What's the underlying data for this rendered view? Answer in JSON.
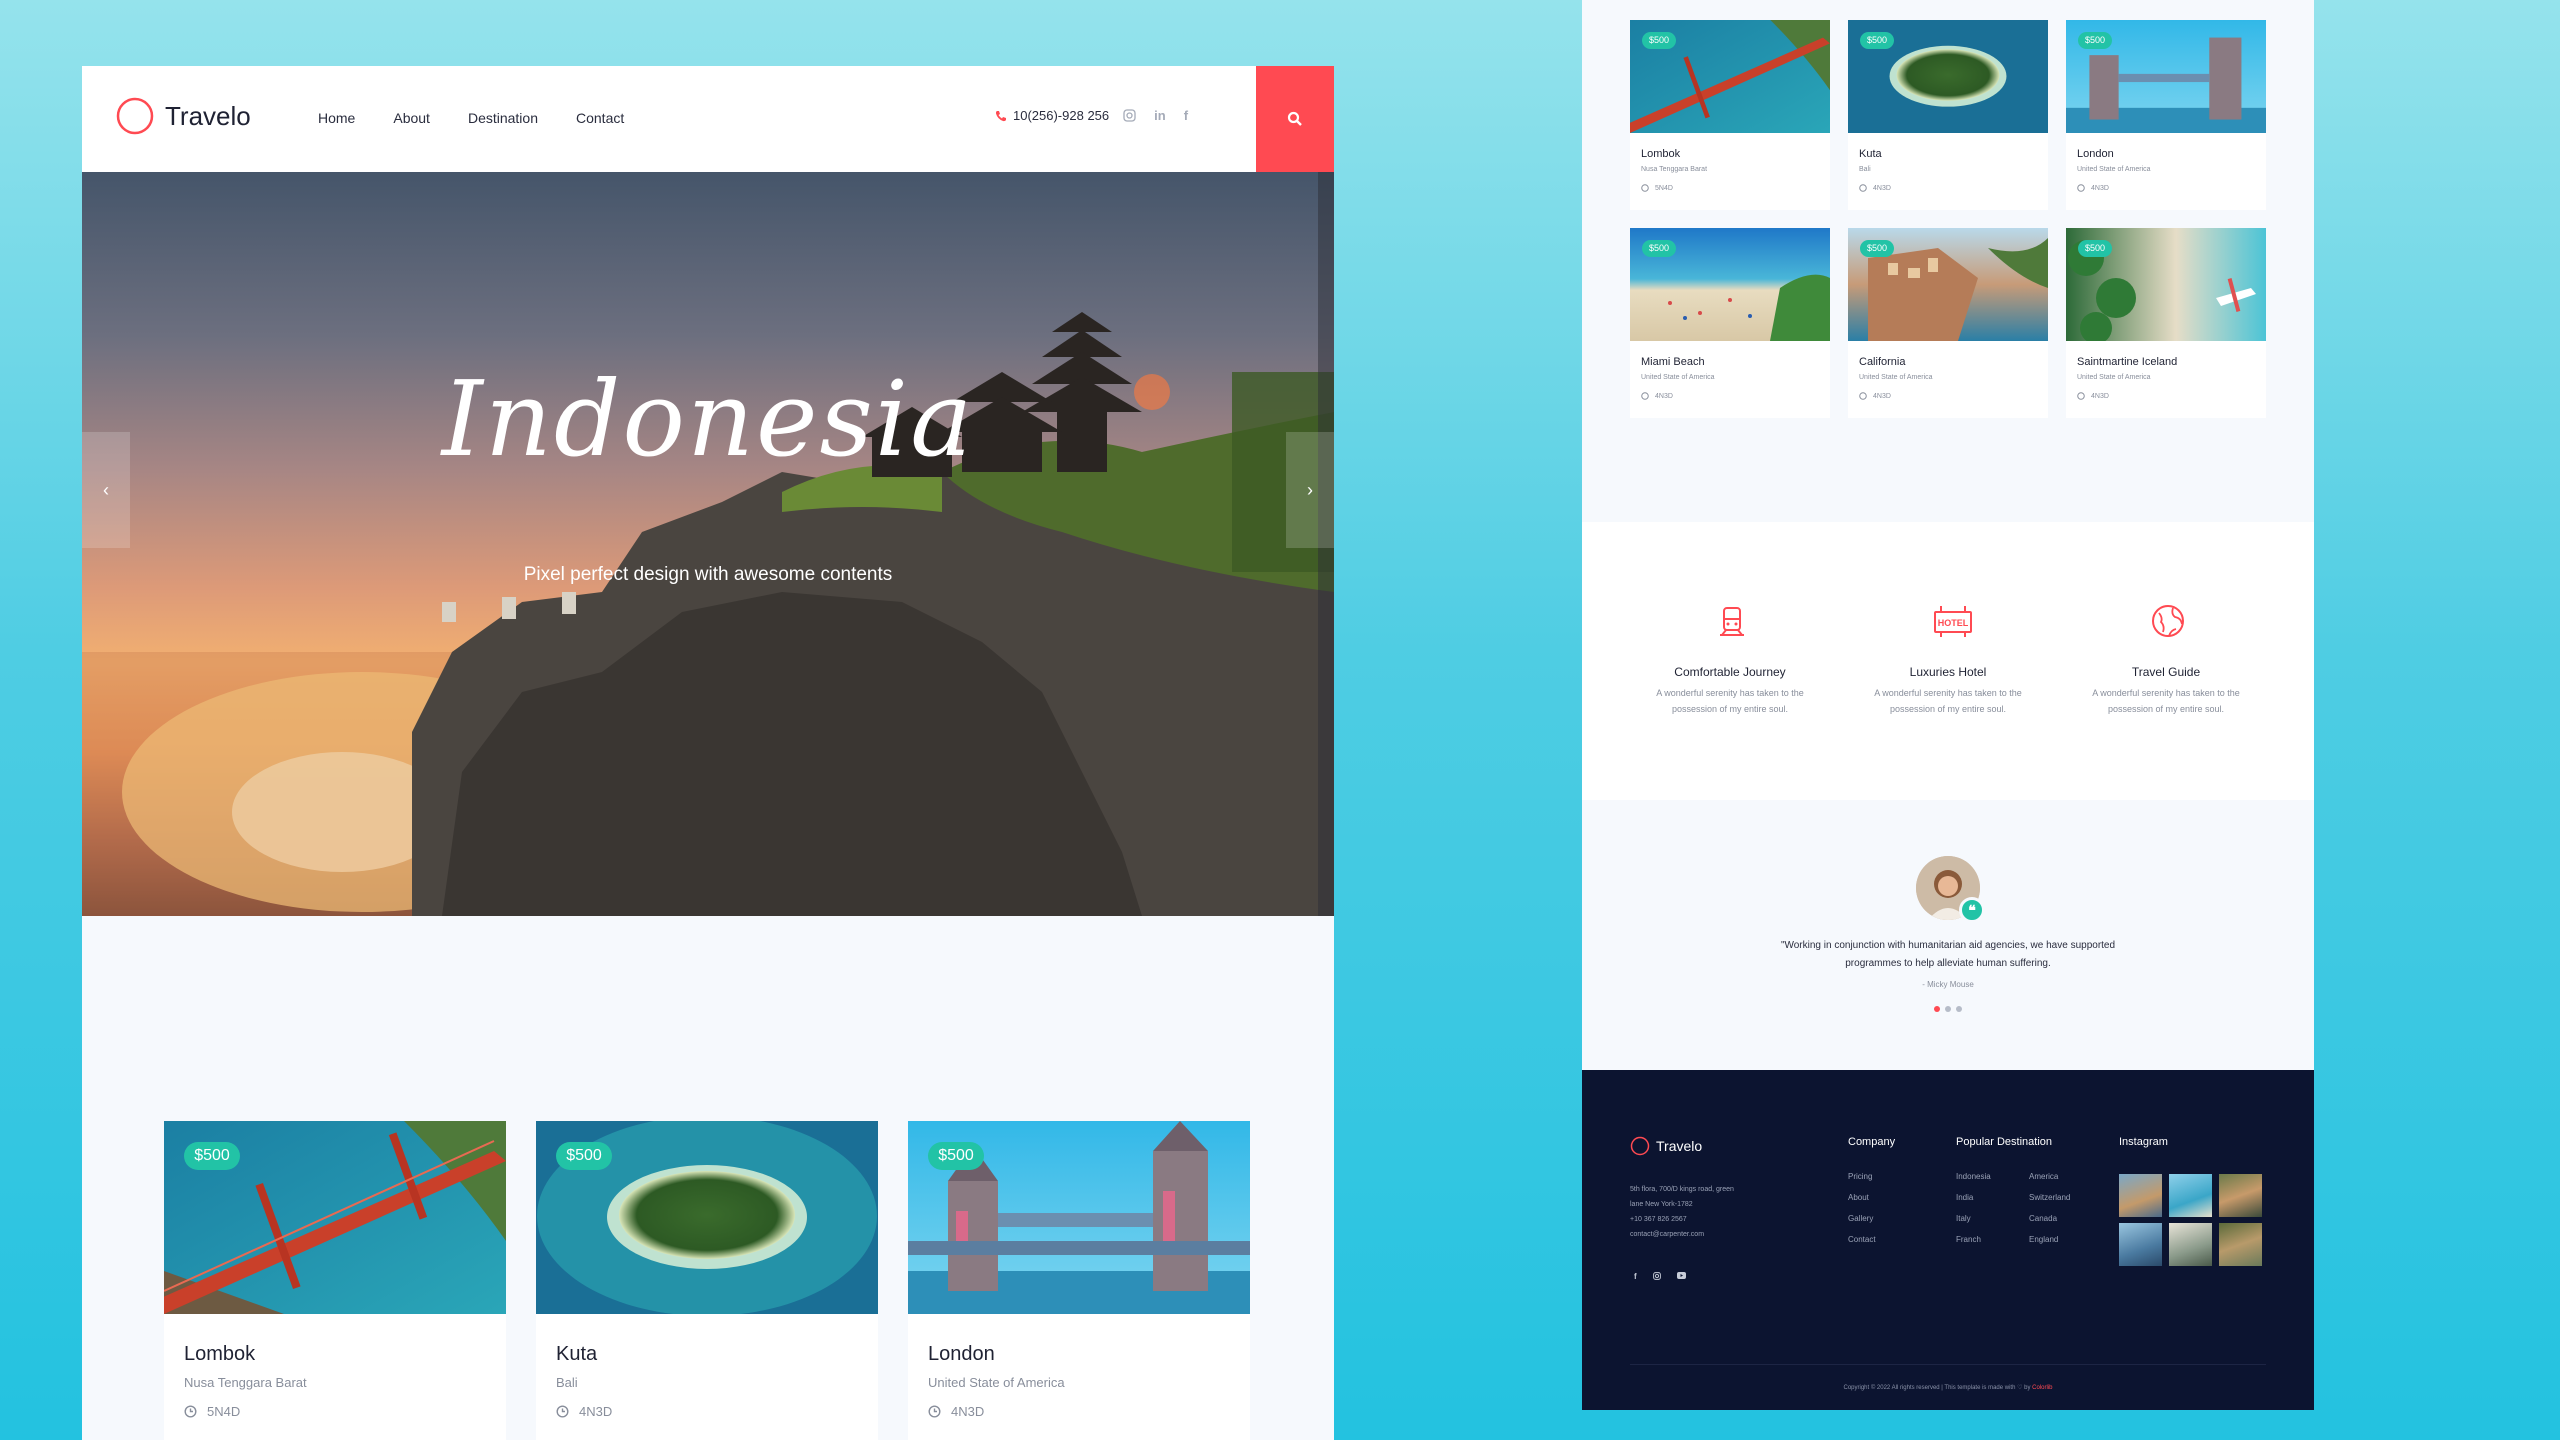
{
  "brand": {
    "name": "Travelo",
    "accent": "#ff4a52",
    "teal": "#22c3a6",
    "footer_bg": "#0c1430"
  },
  "nav": {
    "items": [
      "Home",
      "About",
      "Destination",
      "Contact"
    ],
    "phone": "10(256)-928 256",
    "social_icons": [
      "instagram-icon",
      "linkedin-icon",
      "facebook-icon"
    ],
    "search_icon": "search-icon"
  },
  "hero": {
    "title": "Indonesia",
    "subtitle": "Pixel perfect design with awesome contents",
    "prev": "‹",
    "next": "›"
  },
  "destinations": [
    {
      "price": "$500",
      "name": "Lombok",
      "location": "Nusa Tenggara Barat",
      "duration": "5N4D"
    },
    {
      "price": "$500",
      "name": "Kuta",
      "location": "Bali",
      "duration": "4N3D"
    },
    {
      "price": "$500",
      "name": "London",
      "location": "United State of America",
      "duration": "4N3D"
    },
    {
      "price": "$500",
      "name": "Miami Beach",
      "location": "United State of America",
      "duration": "4N3D"
    },
    {
      "price": "$500",
      "name": "California",
      "location": "United State of America",
      "duration": "4N3D"
    },
    {
      "price": "$500",
      "name": "Saintmartine Iceland",
      "location": "United State of America",
      "duration": "4N3D"
    }
  ],
  "features": [
    {
      "icon": "train-icon",
      "title": "Comfortable Journey",
      "text": "A wonderful serenity has taken to the possession of my entire soul."
    },
    {
      "icon": "hotel-icon",
      "title": "Luxuries Hotel",
      "text": "A wonderful serenity has taken to the possession of my entire soul."
    },
    {
      "icon": "globe-icon",
      "title": "Travel Guide",
      "text": "A wonderful serenity has taken to the possession of my entire soul."
    }
  ],
  "testimonial": {
    "quote": "\"Working in conjunction with humanitarian aid agencies, we have supported programmes to help alleviate human suffering.",
    "author": "- Micky Mouse",
    "dots": 3,
    "active_dot": 0
  },
  "footer": {
    "brand": "Travelo",
    "address_lines": [
      "5th flora, 700/D kings road, green",
      "lane New York-1782",
      "+10 367 826 2567",
      "contact@carpenter.com"
    ],
    "social_icons": [
      "facebook-icon",
      "instagram-icon",
      "youtube-icon"
    ],
    "company_heading": "Company",
    "company_links": [
      "Pricing",
      "About",
      "Gallery",
      "Contact"
    ],
    "popular_heading": "Popular Destination",
    "popular_col1": [
      "Indonesia",
      "India",
      "Italy",
      "Franch"
    ],
    "popular_col2": [
      "America",
      "Switzerland",
      "Canada",
      "England"
    ],
    "instagram_heading": "Instagram",
    "copyright_text": "Copyright © 2022 All rights reserved | This template is made with ♡ by",
    "copyright_link": "Colorlib"
  }
}
